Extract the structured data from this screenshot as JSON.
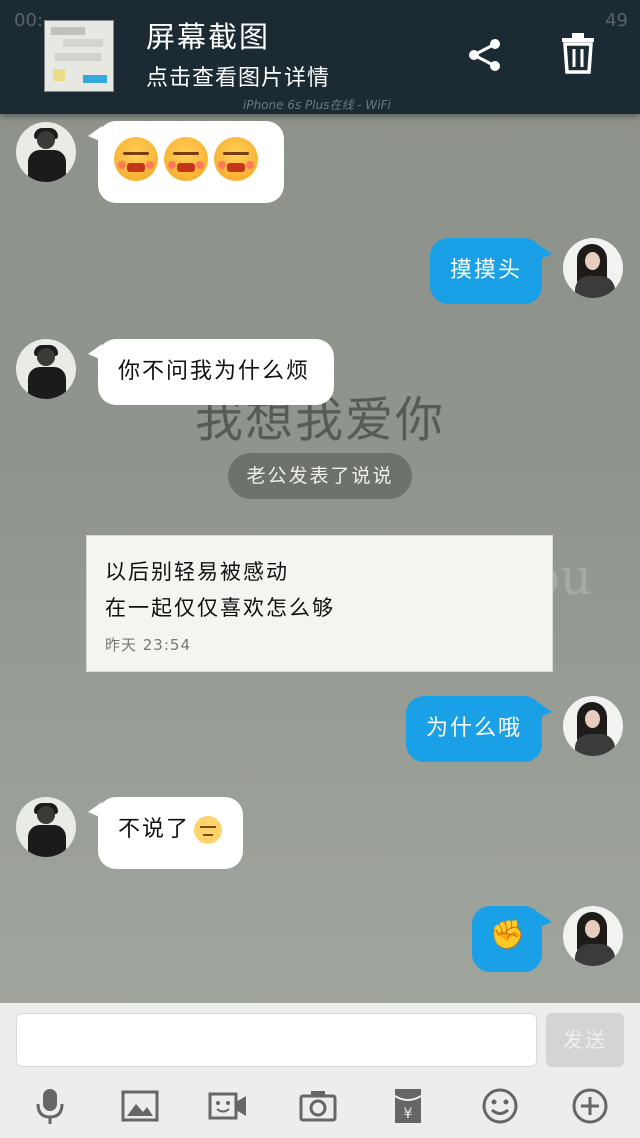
{
  "notification": {
    "status_time": "00:",
    "status_right": "49",
    "title": "屏幕截图",
    "subtitle": "点击查看图片详情"
  },
  "device_line": "iPhone 6s Plus在线 - WiFi",
  "background_text": {
    "line1": "我想我爱你",
    "line2": "i love you"
  },
  "messages": [
    {
      "side": "left",
      "text": "",
      "kind": "emoji",
      "emojis": [
        "angry-face",
        "angry-face",
        "angry-face"
      ]
    },
    {
      "side": "right",
      "text": "摸摸头"
    },
    {
      "side": "left",
      "text": "你不问我为什么烦"
    },
    {
      "side": "right",
      "text": "为什么哦"
    },
    {
      "side": "left",
      "text": "不说了"
    },
    {
      "side": "right",
      "text": "",
      "kind": "emoji",
      "emojis": [
        "fist-bump"
      ]
    }
  ],
  "system_message": "老公发表了说说",
  "post_card": {
    "line1": "以后别轻易被感动",
    "line2": "在一起仅仅喜欢怎么够",
    "time": "昨天 23:54"
  },
  "input": {
    "placeholder": "",
    "send_label": "发送"
  },
  "toolbar": [
    "mic-icon",
    "image-icon",
    "video-icon",
    "camera-icon",
    "red-packet-icon",
    "emoji-icon",
    "plus-icon"
  ],
  "colors": {
    "bubble_right": "#1aa0e6",
    "bubble_left": "#ffffff",
    "notification_bg": "#1b2a33"
  }
}
